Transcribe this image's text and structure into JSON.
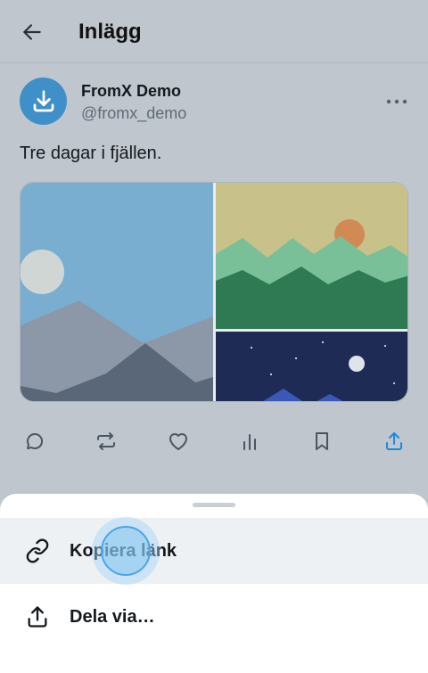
{
  "header": {
    "title": "Inlägg",
    "back_icon": "arrow-left-icon"
  },
  "post": {
    "author_name": "FromX Demo",
    "author_handle": "@fromx_demo",
    "avatar_icon": "download-icon",
    "more_icon": "more-horizontal-icon",
    "text": "Tre dagar i fjällen.",
    "media": [
      {
        "kind": "image",
        "scene": "mountains-day"
      },
      {
        "kind": "image",
        "scene": "hills-sunset"
      },
      {
        "kind": "image",
        "scene": "night-sky"
      }
    ],
    "actions": [
      {
        "name": "reply",
        "icon": "comment-icon"
      },
      {
        "name": "repost",
        "icon": "repost-icon"
      },
      {
        "name": "like",
        "icon": "heart-icon"
      },
      {
        "name": "views",
        "icon": "bar-chart-icon"
      },
      {
        "name": "bookmark",
        "icon": "bookmark-icon"
      },
      {
        "name": "share",
        "icon": "share-icon",
        "active": true
      }
    ]
  },
  "share_sheet": {
    "items": [
      {
        "label": "Kopiera länk",
        "icon": "link-icon",
        "highlighted": true
      },
      {
        "label": "Dela via…",
        "icon": "share-icon"
      }
    ]
  },
  "colors": {
    "accent": "#1d8ad9",
    "background_dimmed": "#bfc6ce",
    "avatar": "#3f8fc8"
  }
}
